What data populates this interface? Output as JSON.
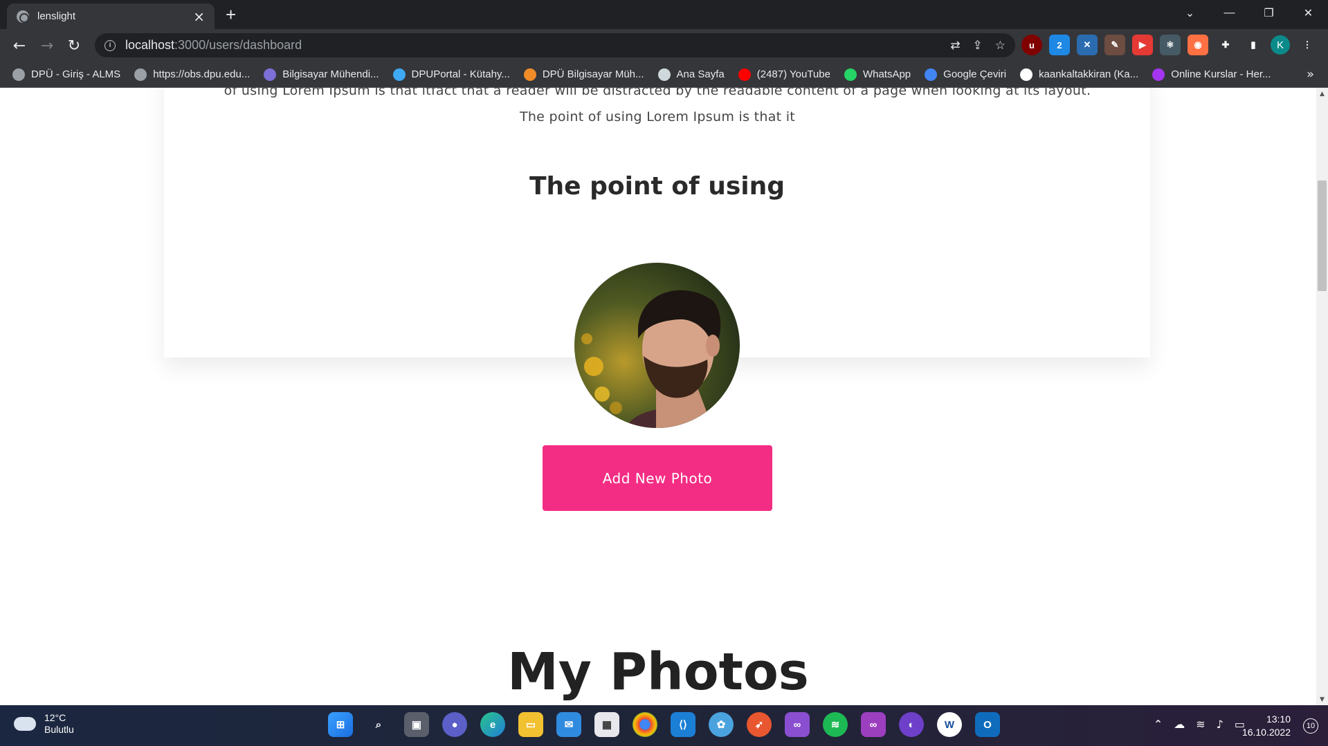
{
  "browser": {
    "tab_title": "lenslight",
    "url_host": "localhost",
    "url_path": ":3000/users/dashboard",
    "bookmarks": [
      {
        "label": "DPÜ - Giriş - ALMS",
        "color": "#9aa0a6"
      },
      {
        "label": "https://obs.dpu.edu...",
        "color": "#9aa0a6"
      },
      {
        "label": "Bilgisayar Mühendi...",
        "color": "#7c6fd6"
      },
      {
        "label": "DPUPortal - Kütahy...",
        "color": "#3fa9f5"
      },
      {
        "label": "DPÜ Bilgisayar Müh...",
        "color": "#f28c28"
      },
      {
        "label": "Ana Sayfa",
        "color": "#cfd8dc"
      },
      {
        "label": "(2487) YouTube",
        "color": "#ff0000"
      },
      {
        "label": "WhatsApp",
        "color": "#25d366"
      },
      {
        "label": "Google Çeviri",
        "color": "#4285f4"
      },
      {
        "label": "kaankaltakkiran (Ka...",
        "color": "#ffffff"
      },
      {
        "label": "Online Kurslar - Her...",
        "color": "#a435f0"
      }
    ],
    "bookmarks_more": "»",
    "profile_initial": "K"
  },
  "page": {
    "lorem_line_1": "of using Lorem Ipsum is that itfact that a reader will be distracted by the readable content of a page when looking at its layout.",
    "lorem_line_2": "The point of using Lorem Ipsum is that it",
    "section_title": "The point of using",
    "add_photo_label": "Add New Photo",
    "photos_heading": "My Photos",
    "accent_color": "#f32d84"
  },
  "taskbar": {
    "temperature": "12°C",
    "weather": "Bulutlu",
    "time": "13:10",
    "date": "16.10.2022",
    "notification_count": "10"
  }
}
